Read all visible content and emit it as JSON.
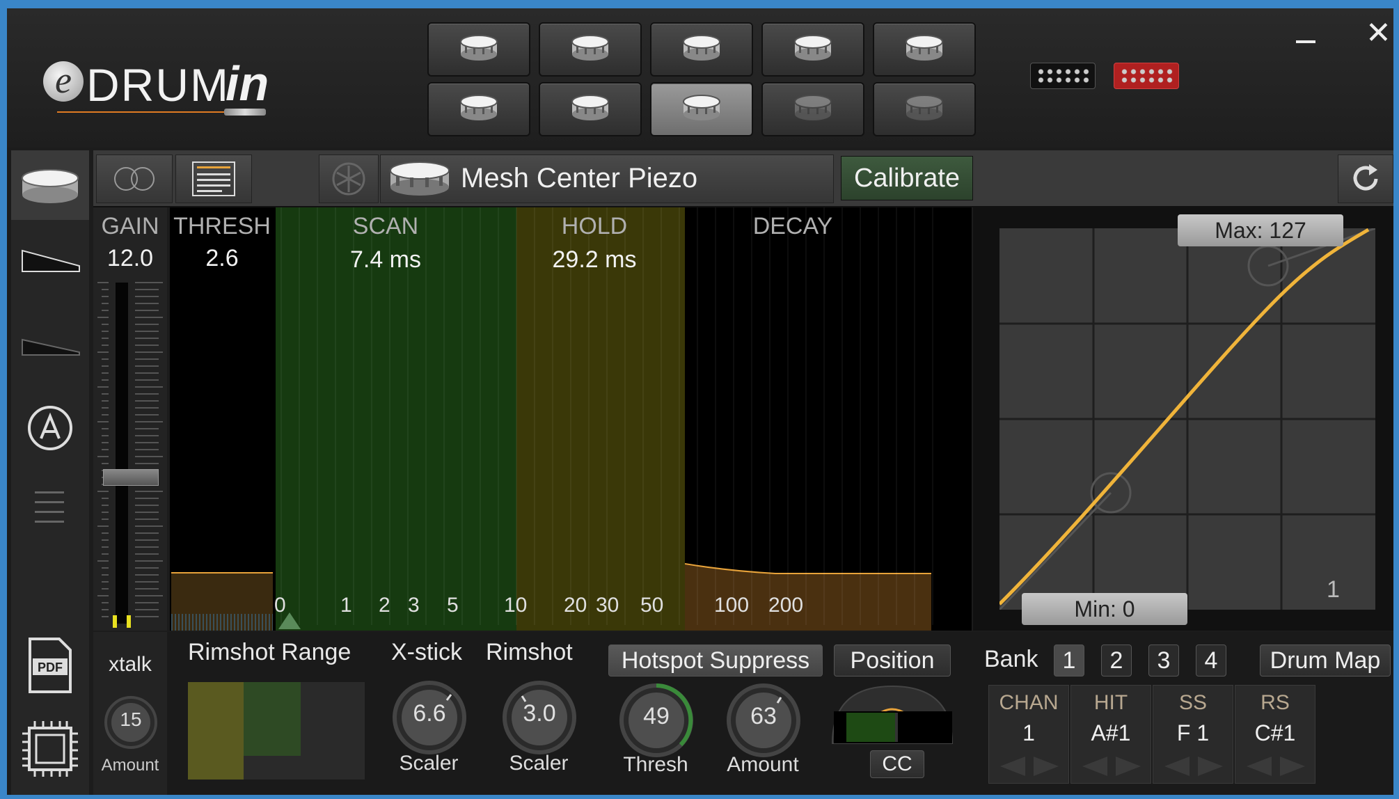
{
  "header": {
    "logo": {
      "e": "e",
      "drum": "DRUM",
      "in": "in"
    },
    "window_controls": {
      "minimize": "–",
      "close": "✕"
    },
    "pads": [
      {
        "state": "normal"
      },
      {
        "state": "normal"
      },
      {
        "state": "normal"
      },
      {
        "state": "normal"
      },
      {
        "state": "normal"
      },
      {
        "state": "normal"
      },
      {
        "state": "normal"
      },
      {
        "state": "active"
      },
      {
        "state": "dim"
      },
      {
        "state": "dim"
      }
    ],
    "connectors": [
      {
        "color": "#111111"
      },
      {
        "color": "#b02020"
      }
    ]
  },
  "toolbar": {
    "drum_name": "Mesh Center Piezo",
    "calibrate_label": "Calibrate"
  },
  "gain": {
    "label": "GAIN",
    "value": "12.0",
    "level": 0.43
  },
  "graph": {
    "thresh": {
      "label": "THRESH",
      "value": "2.6"
    },
    "scan": {
      "label": "SCAN",
      "value": "7.4 ms"
    },
    "hold": {
      "label": "HOLD",
      "value": "29.2 ms"
    },
    "decay": {
      "label": "DECAY"
    },
    "ticks": [
      "0",
      "1",
      "2",
      "3",
      "5",
      "10",
      "20",
      "30",
      "50",
      "100",
      "200"
    ]
  },
  "curve": {
    "max_label": "Max: 127",
    "min_label": "Min: 0",
    "curve_number": "1"
  },
  "bottom": {
    "xtalk": {
      "label": "xtalk",
      "value": "15",
      "caption": "Amount"
    },
    "rimshot_range": {
      "label": "Rimshot Range"
    },
    "xstick": {
      "label": "X-stick",
      "value": "6.6",
      "caption": "Scaler"
    },
    "rimshot": {
      "label": "Rimshot",
      "value": "3.0",
      "caption": "Scaler"
    },
    "hotspot": {
      "label": "Hotspot Suppress"
    },
    "hotspot_thresh": {
      "value": "49",
      "caption": "Thresh"
    },
    "hotspot_amount": {
      "value": "63",
      "caption": "Amount"
    },
    "position": {
      "label": "Position",
      "cc_label": "CC"
    },
    "bank": {
      "label": "Bank",
      "options": [
        "1",
        "2",
        "3",
        "4"
      ],
      "selected": "1"
    },
    "drum_map_label": "Drum Map",
    "midi": [
      {
        "title": "CHAN",
        "value": "1"
      },
      {
        "title": "HIT",
        "value": "A#1"
      },
      {
        "title": "SS",
        "value": "F 1"
      },
      {
        "title": "RS",
        "value": "C#1"
      }
    ]
  },
  "colors": {
    "accent": "#e8a33a",
    "scan": "#1e4a14",
    "hold": "#4a4a08",
    "decay": "#5a3a10"
  }
}
